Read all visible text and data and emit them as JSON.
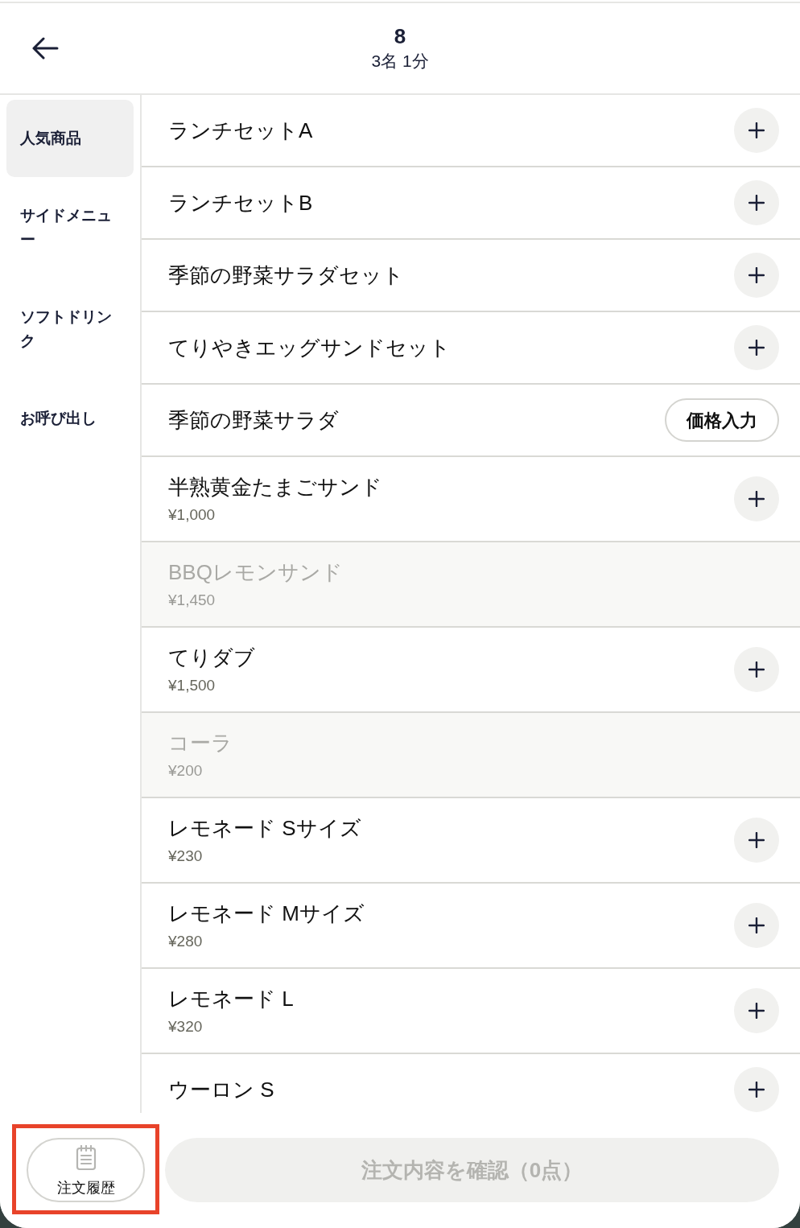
{
  "header": {
    "title": "8",
    "subtitle": "3名 1分"
  },
  "categories": [
    {
      "label": "人気商品",
      "selected": true
    },
    {
      "label": "サイドメニュー",
      "selected": false
    },
    {
      "label": "ソフトドリンク",
      "selected": false
    },
    {
      "label": "お呼び出し",
      "selected": false
    }
  ],
  "items": [
    {
      "name": "ランチセットA",
      "kind": "add",
      "disabled": false
    },
    {
      "name": "ランチセットB",
      "kind": "add",
      "disabled": false
    },
    {
      "name": "季節の野菜サラダセット",
      "kind": "add",
      "disabled": false
    },
    {
      "name": "てりやきエッグサンドセット",
      "kind": "add",
      "disabled": false
    },
    {
      "name": "季節の野菜サラダ",
      "kind": "price_input",
      "button_label": "価格入力",
      "disabled": false
    },
    {
      "name": "半熟黄金たまごサンド",
      "price": "¥1,000",
      "kind": "add",
      "disabled": false
    },
    {
      "name": "BBQレモンサンド",
      "price": "¥1,450",
      "disabled": true
    },
    {
      "name": "てりダブ",
      "price": "¥1,500",
      "kind": "add",
      "disabled": false
    },
    {
      "name": "コーラ",
      "price": "¥200",
      "disabled": true
    },
    {
      "name": "レモネード Sサイズ",
      "price": "¥230",
      "kind": "add",
      "disabled": false
    },
    {
      "name": "レモネード Mサイズ",
      "price": "¥280",
      "kind": "add",
      "disabled": false
    },
    {
      "name": "レモネード L",
      "price": "¥320",
      "kind": "add",
      "disabled": false
    },
    {
      "name": "ウーロン S",
      "kind": "add",
      "disabled": false
    }
  ],
  "footer": {
    "history_button": {
      "label": "注文履歴",
      "highlighted": true
    },
    "confirm_button": {
      "label": "注文内容を確認（0点）",
      "disabled": true
    }
  }
}
